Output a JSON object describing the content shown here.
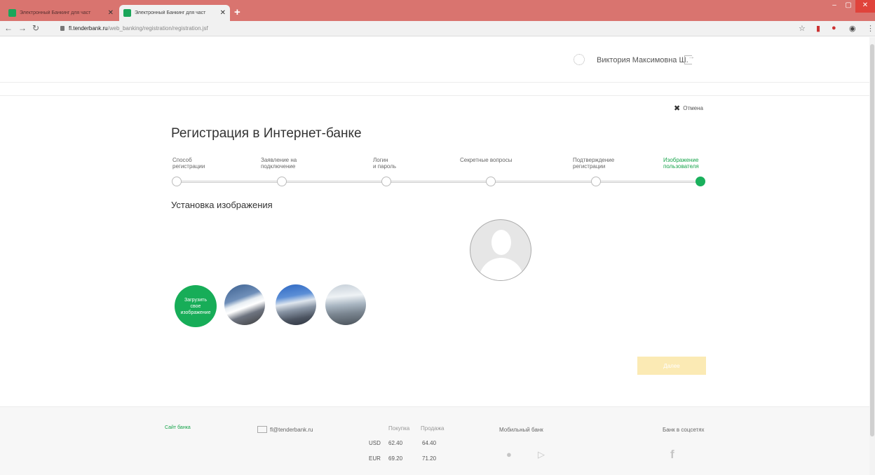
{
  "browser": {
    "tabs": [
      {
        "title": "Электронный Банкинг для част",
        "active": false
      },
      {
        "title": "Электронный Банкинг для част",
        "active": true
      }
    ],
    "new_tab": "+",
    "url_host": "fl.tenderbank.ru",
    "url_path": "/web_banking/registration/registration.jsf"
  },
  "header": {
    "user_name": "Виктория Максимовна Ш."
  },
  "cancel_label": "Отмена",
  "title": "Регистрация в Интернет-банке",
  "steps": [
    {
      "label": "Способ\nрегистрации",
      "active": false
    },
    {
      "label": "Заявление на\nподключение",
      "active": false
    },
    {
      "label": "Логин\nи пароль",
      "active": false
    },
    {
      "label": "Секретные вопросы",
      "active": false
    },
    {
      "label": "Подтверждение\nрегистрации",
      "active": false
    },
    {
      "label": "Изображение\nпользователя",
      "active": true
    }
  ],
  "section_title": "Установка изображения",
  "upload_label": "Загрузить\nсвое\nизображение",
  "next_label": "Далее",
  "footer": {
    "bank_site": "Сайт банка",
    "email": "fl@tenderbank.ru",
    "buy_label": "Покупка",
    "sell_label": "Продажа",
    "currencies": [
      {
        "code": "USD",
        "buy": "62.40",
        "sell": "64.40"
      },
      {
        "code": "EUR",
        "buy": "69.20",
        "sell": "71.20"
      }
    ],
    "mobile_bank": "Мобильный банк",
    "social": "Банк в соцсетях"
  }
}
